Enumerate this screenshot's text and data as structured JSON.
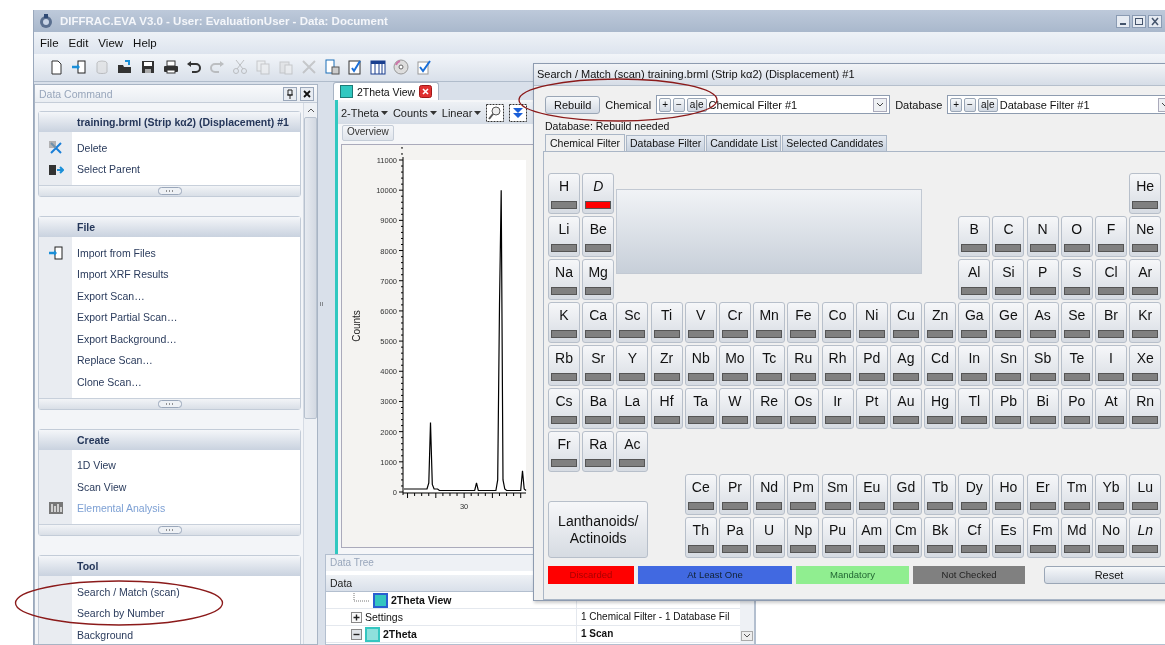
{
  "window": {
    "title": "DIFFRAC.EVA V3.0 - User: EvaluationUser - Data: Document"
  },
  "menu": [
    "File",
    "Edit",
    "View",
    "Help"
  ],
  "toolbar": [
    {
      "disabled": false
    },
    {
      "disabled": false
    },
    {
      "disabled": true
    },
    {
      "disabled": false
    },
    {
      "disabled": false
    },
    {
      "disabled": false
    },
    {
      "disabled": false
    },
    {
      "disabled": true
    },
    {
      "disabled": true
    },
    {
      "disabled": true
    },
    {
      "disabled": true
    },
    {
      "disabled": true
    },
    {
      "disabled": false
    },
    {
      "disabled": false
    },
    {
      "disabled": false
    },
    {
      "disabled": false
    },
    {
      "disabled": false
    }
  ],
  "data_command": {
    "title": "Data Command",
    "sections": [
      {
        "title": "training.brml (Strip kα2) (Displacement) #1",
        "items": [
          {
            "label": "Delete",
            "disabled": false
          },
          {
            "label": "Select Parent",
            "disabled": false
          }
        ]
      },
      {
        "title": "File",
        "items": [
          {
            "label": "Import from Files",
            "disabled": false
          },
          {
            "label": "Import XRF Results",
            "disabled": false
          },
          {
            "label": "Export Scan…",
            "disabled": false
          },
          {
            "label": "Export Partial Scan…",
            "disabled": false
          },
          {
            "label": "Export Background…",
            "disabled": false
          },
          {
            "label": "Replace Scan…",
            "disabled": false
          },
          {
            "label": "Clone Scan…",
            "disabled": false
          }
        ]
      },
      {
        "title": "Create",
        "items": [
          {
            "label": "1D View",
            "disabled": false
          },
          {
            "label": "Scan View",
            "disabled": false
          },
          {
            "label": "Elemental Analysis",
            "disabled": true
          }
        ]
      },
      {
        "title": "Tool",
        "items": [
          {
            "label": "Search / Match (scan)",
            "disabled": false
          },
          {
            "label": "Search by Number",
            "disabled": false
          },
          {
            "label": "Background",
            "disabled": false
          }
        ]
      }
    ]
  },
  "view": {
    "tab": "2Theta View",
    "axis_menus": [
      "2-Theta",
      "Counts",
      "Linear"
    ],
    "subtab": "Overview",
    "chart_data": {
      "type": "line",
      "ylabel": "Counts",
      "ylim": [
        0,
        11000
      ],
      "yticks": [
        0,
        1000,
        2000,
        3000,
        4000,
        5000,
        6000,
        7000,
        8000,
        9000,
        10000,
        11000
      ],
      "series": [
        {
          "color": "#000000",
          "values": [
            100,
            100,
            100,
            100,
            100,
            100,
            100,
            100,
            100,
            100,
            100,
            100,
            100,
            100,
            300,
            2300,
            250,
            100,
            100,
            100,
            50,
            50,
            50,
            50,
            50,
            50,
            50,
            50,
            50,
            50,
            50,
            50,
            50,
            50,
            50,
            50,
            50,
            50,
            50,
            50,
            50,
            300,
            50,
            50,
            50,
            50,
            50,
            50,
            50,
            50,
            50,
            50,
            50,
            400,
            6200,
            10000,
            400,
            100,
            50,
            50,
            50,
            50,
            50,
            50,
            50,
            50,
            50,
            700,
            100,
            50
          ]
        }
      ],
      "annotations": [
        "30"
      ]
    }
  },
  "data_tree": {
    "title": "Data Tree",
    "column": "Data",
    "rows": [
      {
        "kind": "leaf",
        "label": "2Theta View",
        "bold": true
      },
      {
        "kind": "node",
        "label": "Settings",
        "value": "1 Chemical Filter - 1 Database Fil",
        "bold": false,
        "expanded": false
      },
      {
        "kind": "node",
        "label": "2Theta",
        "value": "1 Scan",
        "bold": true,
        "expanded": true
      }
    ]
  },
  "dialog": {
    "title": "Search / Match (scan) training.brml (Strip kα2) (Displacement) #1",
    "rebuild": "Rebuild",
    "chemical_label": "Chemical",
    "chemical_filter": "Chemical Filter #1",
    "chemical_buttons": [
      "+",
      "−",
      "a|e"
    ],
    "database_label": "Database",
    "database_filter": "Database Filter #1",
    "database_buttons": [
      "+",
      "−",
      "a|e"
    ],
    "status": "Database: Rebuild needed",
    "tabs": [
      {
        "label": "Chemical Filter",
        "selected": true
      },
      {
        "label": "Database Filter",
        "selected": false
      },
      {
        "label": "Candidate List",
        "selected": false
      },
      {
        "label": "Selected Candidates",
        "selected": false
      }
    ],
    "periodic_table": {
      "rows": [
        [
          {
            "symbol": "H",
            "color": "#808080",
            "italic": false
          },
          {
            "symbol": "D",
            "color": "#ff0000",
            "italic": true
          },
          null,
          null,
          null,
          null,
          null,
          null,
          null,
          null,
          null,
          null,
          null,
          null,
          null,
          null,
          null,
          {
            "symbol": "He",
            "color": "#808080",
            "italic": false
          }
        ],
        [
          {
            "symbol": "Li",
            "color": "#808080",
            "italic": false
          },
          {
            "symbol": "Be",
            "color": "#808080",
            "italic": false
          },
          null,
          null,
          null,
          null,
          null,
          null,
          null,
          null,
          null,
          null,
          {
            "symbol": "B",
            "color": "#808080",
            "italic": false
          },
          {
            "symbol": "C",
            "color": "#808080",
            "italic": false
          },
          {
            "symbol": "N",
            "color": "#808080",
            "italic": false
          },
          {
            "symbol": "O",
            "color": "#808080",
            "italic": false
          },
          {
            "symbol": "F",
            "color": "#808080",
            "italic": false
          },
          {
            "symbol": "Ne",
            "color": "#808080",
            "italic": false
          }
        ],
        [
          {
            "symbol": "Na",
            "color": "#808080",
            "italic": false
          },
          {
            "symbol": "Mg",
            "color": "#808080",
            "italic": false
          },
          null,
          null,
          null,
          null,
          null,
          null,
          null,
          null,
          null,
          null,
          {
            "symbol": "Al",
            "color": "#808080",
            "italic": false
          },
          {
            "symbol": "Si",
            "color": "#808080",
            "italic": false
          },
          {
            "symbol": "P",
            "color": "#808080",
            "italic": false
          },
          {
            "symbol": "S",
            "color": "#808080",
            "italic": false
          },
          {
            "symbol": "Cl",
            "color": "#808080",
            "italic": false
          },
          {
            "symbol": "Ar",
            "color": "#808080",
            "italic": false
          }
        ],
        [
          {
            "symbol": "K",
            "color": "#808080",
            "italic": false
          },
          {
            "symbol": "Ca",
            "color": "#808080",
            "italic": false
          },
          {
            "symbol": "Sc",
            "color": "#808080",
            "italic": false
          },
          {
            "symbol": "Ti",
            "color": "#808080",
            "italic": false
          },
          {
            "symbol": "V",
            "color": "#808080",
            "italic": false
          },
          {
            "symbol": "Cr",
            "color": "#808080",
            "italic": false
          },
          {
            "symbol": "Mn",
            "color": "#808080",
            "italic": false
          },
          {
            "symbol": "Fe",
            "color": "#808080",
            "italic": false
          },
          {
            "symbol": "Co",
            "color": "#808080",
            "italic": false
          },
          {
            "symbol": "Ni",
            "color": "#808080",
            "italic": false
          },
          {
            "symbol": "Cu",
            "color": "#808080",
            "italic": false
          },
          {
            "symbol": "Zn",
            "color": "#808080",
            "italic": false
          },
          {
            "symbol": "Ga",
            "color": "#808080",
            "italic": false
          },
          {
            "symbol": "Ge",
            "color": "#808080",
            "italic": false
          },
          {
            "symbol": "As",
            "color": "#808080",
            "italic": false
          },
          {
            "symbol": "Se",
            "color": "#808080",
            "italic": false
          },
          {
            "symbol": "Br",
            "color": "#808080",
            "italic": false
          },
          {
            "symbol": "Kr",
            "color": "#808080",
            "italic": false
          }
        ],
        [
          {
            "symbol": "Rb",
            "color": "#808080",
            "italic": false
          },
          {
            "symbol": "Sr",
            "color": "#808080",
            "italic": false
          },
          {
            "symbol": "Y",
            "color": "#808080",
            "italic": false
          },
          {
            "symbol": "Zr",
            "color": "#808080",
            "italic": false
          },
          {
            "symbol": "Nb",
            "color": "#808080",
            "italic": false
          },
          {
            "symbol": "Mo",
            "color": "#808080",
            "italic": false
          },
          {
            "symbol": "Tc",
            "color": "#808080",
            "italic": false
          },
          {
            "symbol": "Ru",
            "color": "#808080",
            "italic": false
          },
          {
            "symbol": "Rh",
            "color": "#808080",
            "italic": false
          },
          {
            "symbol": "Pd",
            "color": "#808080",
            "italic": false
          },
          {
            "symbol": "Ag",
            "color": "#808080",
            "italic": false
          },
          {
            "symbol": "Cd",
            "color": "#808080",
            "italic": false
          },
          {
            "symbol": "In",
            "color": "#808080",
            "italic": false
          },
          {
            "symbol": "Sn",
            "color": "#808080",
            "italic": false
          },
          {
            "symbol": "Sb",
            "color": "#808080",
            "italic": false
          },
          {
            "symbol": "Te",
            "color": "#808080",
            "italic": false
          },
          {
            "symbol": "I",
            "color": "#808080",
            "italic": false
          },
          {
            "symbol": "Xe",
            "color": "#808080",
            "italic": false
          }
        ],
        [
          {
            "symbol": "Cs",
            "color": "#808080",
            "italic": false
          },
          {
            "symbol": "Ba",
            "color": "#808080",
            "italic": false
          },
          {
            "symbol": "La",
            "color": "#808080",
            "italic": false
          },
          {
            "symbol": "Hf",
            "color": "#808080",
            "italic": false
          },
          {
            "symbol": "Ta",
            "color": "#808080",
            "italic": false
          },
          {
            "symbol": "W",
            "color": "#808080",
            "italic": false
          },
          {
            "symbol": "Re",
            "color": "#808080",
            "italic": false
          },
          {
            "symbol": "Os",
            "color": "#808080",
            "italic": false
          },
          {
            "symbol": "Ir",
            "color": "#808080",
            "italic": false
          },
          {
            "symbol": "Pt",
            "color": "#808080",
            "italic": false
          },
          {
            "symbol": "Au",
            "color": "#808080",
            "italic": false
          },
          {
            "symbol": "Hg",
            "color": "#808080",
            "italic": false
          },
          {
            "symbol": "Tl",
            "color": "#808080",
            "italic": false
          },
          {
            "symbol": "Pb",
            "color": "#808080",
            "italic": false
          },
          {
            "symbol": "Bi",
            "color": "#808080",
            "italic": false
          },
          {
            "symbol": "Po",
            "color": "#808080",
            "italic": false
          },
          {
            "symbol": "At",
            "color": "#808080",
            "italic": false
          },
          {
            "symbol": "Rn",
            "color": "#808080",
            "italic": false
          }
        ],
        [
          {
            "symbol": "Fr",
            "color": "#808080",
            "italic": false
          },
          {
            "symbol": "Ra",
            "color": "#808080",
            "italic": false
          },
          {
            "symbol": "Ac",
            "color": "#808080",
            "italic": false
          },
          null,
          null,
          null,
          null,
          null,
          null,
          null,
          null,
          null,
          null,
          null,
          null,
          null,
          null,
          null
        ],
        [
          null,
          null,
          null,
          null,
          {
            "symbol": "Ce",
            "color": "#808080",
            "italic": false
          },
          {
            "symbol": "Pr",
            "color": "#808080",
            "italic": false
          },
          {
            "symbol": "Nd",
            "color": "#808080",
            "italic": false
          },
          {
            "symbol": "Pm",
            "color": "#808080",
            "italic": false
          },
          {
            "symbol": "Sm",
            "color": "#808080",
            "italic": false
          },
          {
            "symbol": "Eu",
            "color": "#808080",
            "italic": false
          },
          {
            "symbol": "Gd",
            "color": "#808080",
            "italic": false
          },
          {
            "symbol": "Tb",
            "color": "#808080",
            "italic": false
          },
          {
            "symbol": "Dy",
            "color": "#808080",
            "italic": false
          },
          {
            "symbol": "Ho",
            "color": "#808080",
            "italic": false
          },
          {
            "symbol": "Er",
            "color": "#808080",
            "italic": false
          },
          {
            "symbol": "Tm",
            "color": "#808080",
            "italic": false
          },
          {
            "symbol": "Yb",
            "color": "#808080",
            "italic": false
          },
          {
            "symbol": "Lu",
            "color": "#808080",
            "italic": false
          }
        ],
        [
          null,
          null,
          null,
          null,
          {
            "symbol": "Th",
            "color": "#808080",
            "italic": false
          },
          {
            "symbol": "Pa",
            "color": "#808080",
            "italic": false
          },
          {
            "symbol": "U",
            "color": "#808080",
            "italic": false
          },
          {
            "symbol": "Np",
            "color": "#808080",
            "italic": false
          },
          {
            "symbol": "Pu",
            "color": "#808080",
            "italic": false
          },
          {
            "symbol": "Am",
            "color": "#808080",
            "italic": false
          },
          {
            "symbol": "Cm",
            "color": "#808080",
            "italic": false
          },
          {
            "symbol": "Bk",
            "color": "#808080",
            "italic": false
          },
          {
            "symbol": "Cf",
            "color": "#808080",
            "italic": false
          },
          {
            "symbol": "Es",
            "color": "#808080",
            "italic": false
          },
          {
            "symbol": "Fm",
            "color": "#808080",
            "italic": false
          },
          {
            "symbol": "Md",
            "color": "#808080",
            "italic": false
          },
          {
            "symbol": "No",
            "color": "#808080",
            "italic": false
          },
          {
            "symbol": "Ln",
            "color": "#808080",
            "italic": true
          }
        ]
      ],
      "series_button": "Lanthanoids/ Actinoids"
    },
    "legend": [
      {
        "label": "Discarded",
        "color": "#ff0000"
      },
      {
        "label": "At Least One",
        "color": "#4169e1"
      },
      {
        "label": "Mandatory",
        "color": "#90ee90"
      },
      {
        "label": "Not Checked",
        "color": "#808080"
      }
    ],
    "reset": "Reset"
  },
  "annotations": [
    {
      "kind": "ellipse"
    },
    {
      "kind": "ellipse"
    }
  ]
}
